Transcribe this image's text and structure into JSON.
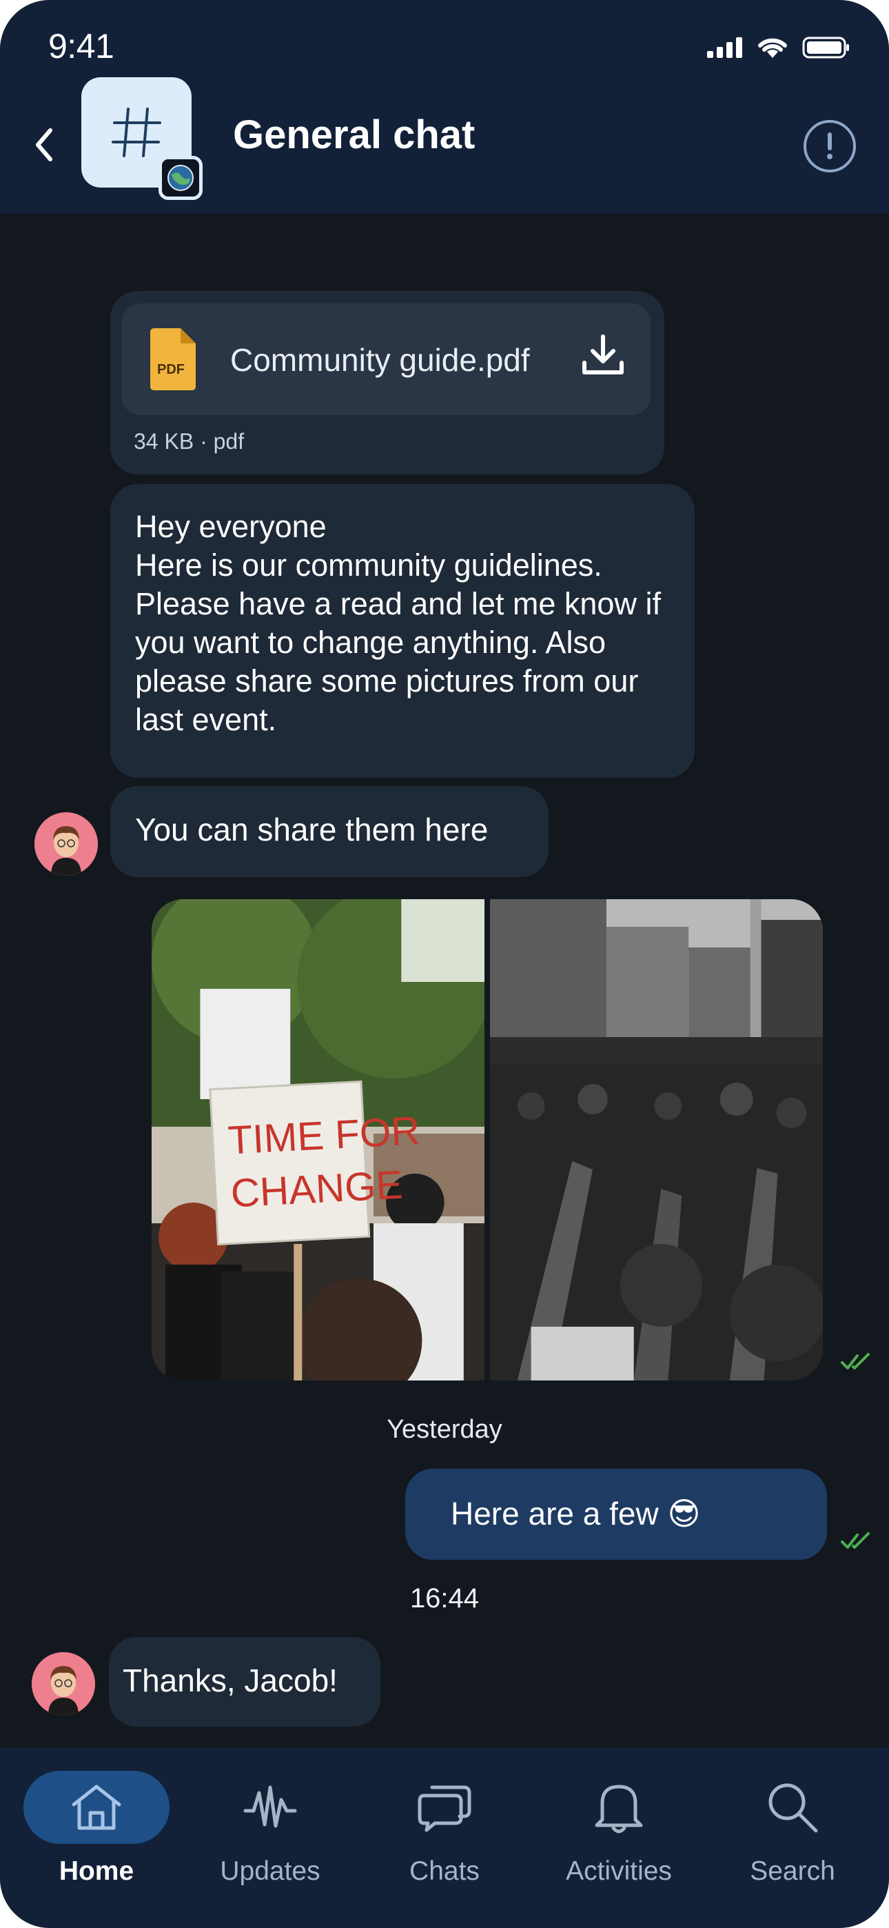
{
  "status_bar": {
    "time": "9:41"
  },
  "header": {
    "title": "General chat"
  },
  "messages": {
    "file": {
      "name": "Community guide.pdf",
      "icon_label": "PDF",
      "size": "34 KB",
      "type": "pdf"
    },
    "guidelines_text": "Hey everyone\nHere is our community guidelines. Please have a read and let me know if you want to change anything. Also please share some pictures from our last event.",
    "share_text": "You can share them here",
    "photo_sign_text": "TIME FOR CHANGE",
    "date_separator": "Yesterday",
    "outgoing_text": "Here are a few 😎",
    "time_separator": "16:44",
    "thanks_text": "Thanks, Jacob!"
  },
  "tabbar": {
    "items": [
      {
        "label": "Home",
        "icon": "home-icon",
        "active": true
      },
      {
        "label": "Updates",
        "icon": "waveform-icon",
        "active": false
      },
      {
        "label": "Chats",
        "icon": "chat-bubbles-icon",
        "active": false
      },
      {
        "label": "Activities",
        "icon": "bell-icon",
        "active": false
      },
      {
        "label": "Search",
        "icon": "search-icon",
        "active": false
      }
    ]
  },
  "colors": {
    "background": "#13171e",
    "header": "#122038",
    "incoming_bubble": "#1f2a38",
    "outgoing_bubble": "#1e3b63",
    "read_tick": "#4caf50",
    "active_tab": "#1e4f86"
  }
}
